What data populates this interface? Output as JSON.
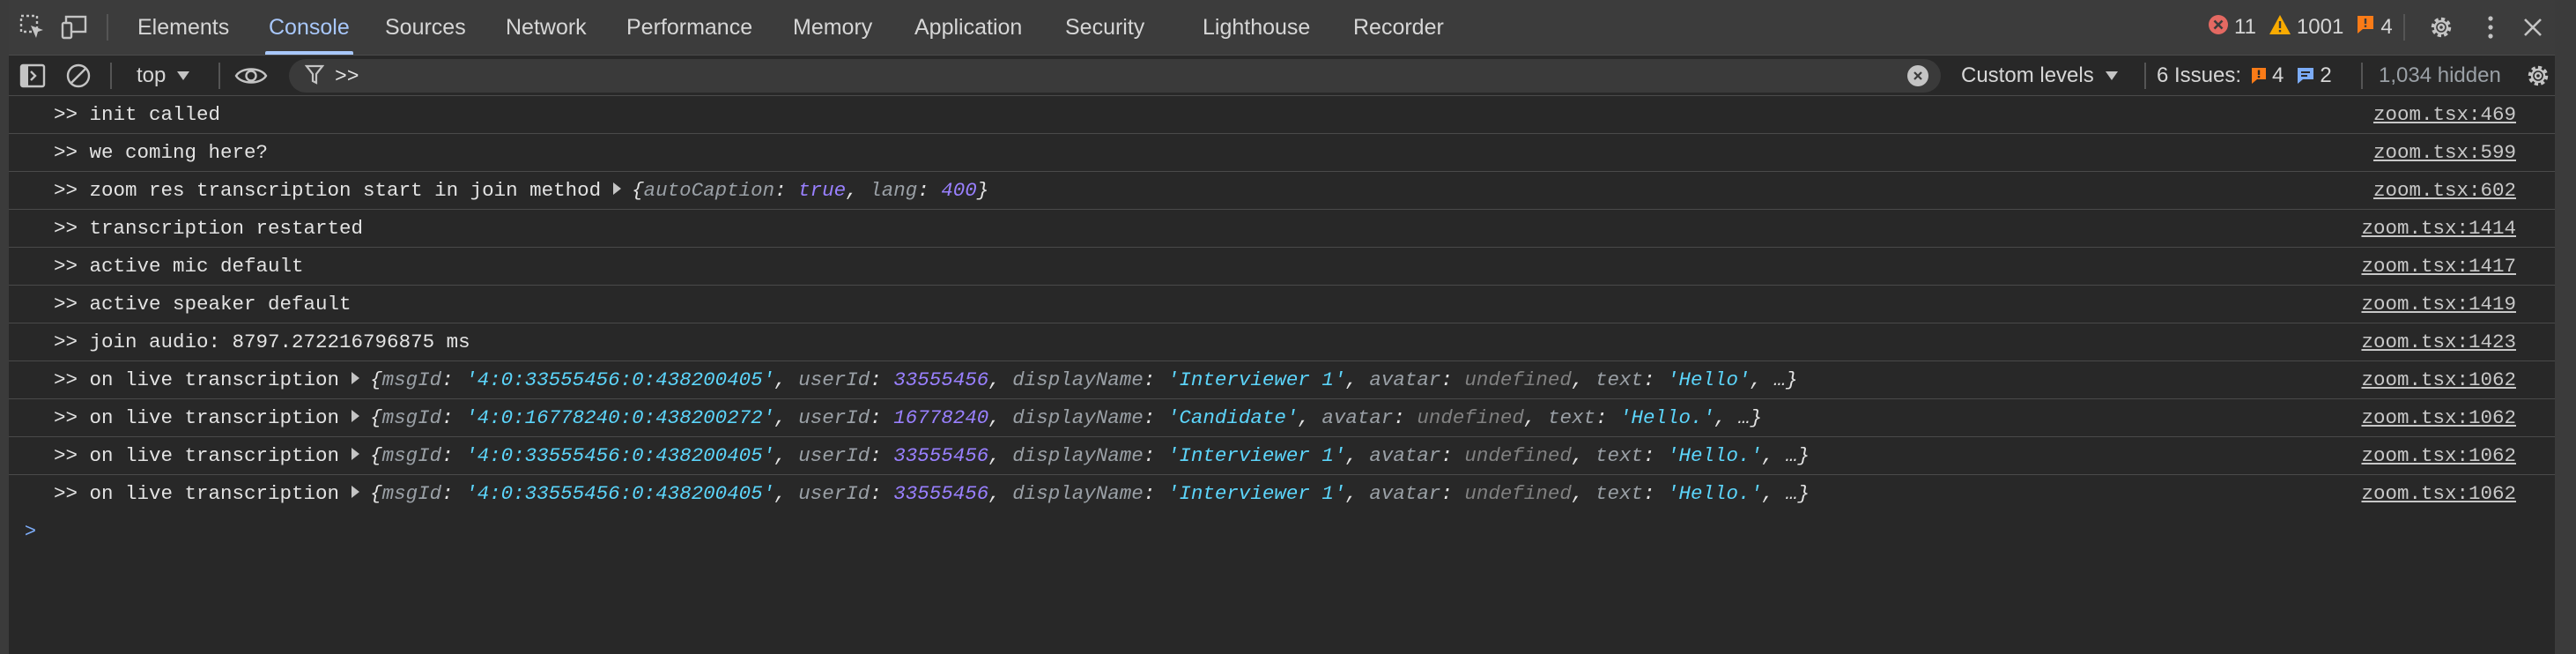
{
  "tabs": [
    {
      "label": "Elements",
      "active": false
    },
    {
      "label": "Console",
      "active": true
    },
    {
      "label": "Sources",
      "active": false
    },
    {
      "label": "Network",
      "active": false
    },
    {
      "label": "Performance",
      "active": false
    },
    {
      "label": "Memory",
      "active": false
    },
    {
      "label": "Application",
      "active": false
    },
    {
      "label": "Security",
      "active": false
    },
    {
      "label": "Lighthouse",
      "active": false
    },
    {
      "label": "Recorder",
      "active": false
    }
  ],
  "counts": {
    "errors": "11",
    "warnings": "1001",
    "issues": "4"
  },
  "filterbar": {
    "context": "top",
    "filter_value": ">>",
    "levels": "Custom levels",
    "issues_label": "6 Issues:",
    "issues_warn": "4",
    "issues_info": "2",
    "hidden": "1,034 hidden"
  },
  "colors": {
    "accent": "#a8c7fa",
    "error": "#e46962",
    "warning": "#f9ab00",
    "issue": "#fa7b17",
    "info": "#7cacf8"
  },
  "logs": [
    {
      "text": ">> init called",
      "source": "zoom.tsx:469"
    },
    {
      "text": ">> we coming here?",
      "source": "zoom.tsx:599"
    },
    {
      "text": ">> zoom res transcription start in join method",
      "source": "zoom.tsx:602",
      "obj": [
        [
          "autoCaption",
          "true",
          "b"
        ],
        [
          "lang",
          "400",
          "n"
        ]
      ],
      "ellipsis": false
    },
    {
      "text": ">> transcription restarted",
      "source": "zoom.tsx:1414"
    },
    {
      "text": ">> active mic default",
      "source": "zoom.tsx:1417"
    },
    {
      "text": ">> active speaker default",
      "source": "zoom.tsx:1419"
    },
    {
      "text": ">> join audio: 8797.272216796875 ms",
      "source": "zoom.tsx:1423"
    },
    {
      "text": ">> on live transcription",
      "source": "zoom.tsx:1062",
      "obj": [
        [
          "msgId",
          "'4:0:33555456:0:438200405'",
          "s"
        ],
        [
          "userId",
          "33555456",
          "n"
        ],
        [
          "displayName",
          "'Interviewer 1'",
          "s"
        ],
        [
          "avatar",
          "undefined",
          "u"
        ],
        [
          "text",
          "'Hello'",
          "s"
        ]
      ],
      "ellipsis": true
    },
    {
      "text": ">> on live transcription",
      "source": "zoom.tsx:1062",
      "obj": [
        [
          "msgId",
          "'4:0:16778240:0:438200272'",
          "s"
        ],
        [
          "userId",
          "16778240",
          "n"
        ],
        [
          "displayName",
          "'Candidate'",
          "s"
        ],
        [
          "avatar",
          "undefined",
          "u"
        ],
        [
          "text",
          "'Hello.'",
          "s"
        ]
      ],
      "ellipsis": true
    },
    {
      "text": ">> on live transcription",
      "source": "zoom.tsx:1062",
      "obj": [
        [
          "msgId",
          "'4:0:33555456:0:438200405'",
          "s"
        ],
        [
          "userId",
          "33555456",
          "n"
        ],
        [
          "displayName",
          "'Interviewer 1'",
          "s"
        ],
        [
          "avatar",
          "undefined",
          "u"
        ],
        [
          "text",
          "'Hello.'",
          "s"
        ]
      ],
      "ellipsis": true
    },
    {
      "text": ">> on live transcription",
      "source": "zoom.tsx:1062",
      "obj": [
        [
          "msgId",
          "'4:0:33555456:0:438200405'",
          "s"
        ],
        [
          "userId",
          "33555456",
          "n"
        ],
        [
          "displayName",
          "'Interviewer 1'",
          "s"
        ],
        [
          "avatar",
          "undefined",
          "u"
        ],
        [
          "text",
          "'Hello.'",
          "s"
        ]
      ],
      "ellipsis": true
    }
  ],
  "prompt": ">"
}
